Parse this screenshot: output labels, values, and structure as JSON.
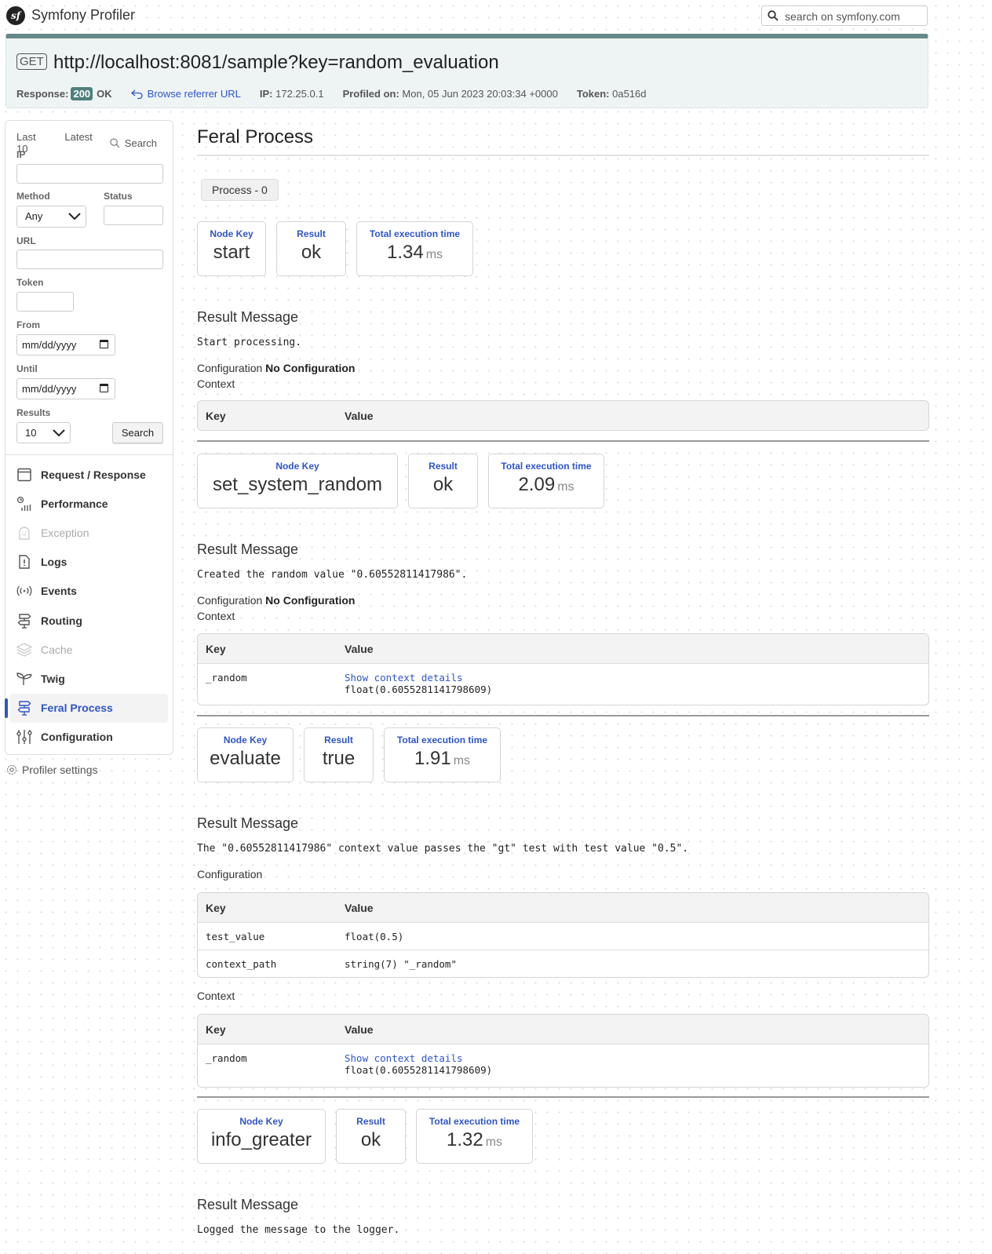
{
  "header": {
    "app_title": "Symfony Profiler",
    "logo_text": "sf",
    "search_placeholder": "search on symfony.com"
  },
  "summary": {
    "method": "GET",
    "url": "http://localhost:8081/sample?key=random_evaluation",
    "response_label": "Response:",
    "status_code": "200",
    "status_text": "OK",
    "referrer_link": "Browse referrer URL",
    "ip_label": "IP:",
    "ip": "172.25.0.1",
    "profiled_label": "Profiled on:",
    "profiled_on": "Mon, 05 Jun 2023 20:03:34 +0000",
    "token_label": "Token:",
    "token": "0a516d",
    "accent_color": "#638a88"
  },
  "sidebar": {
    "tabs": [
      "Last 10",
      "Latest",
      "Search"
    ],
    "form": {
      "ip_label": "IP",
      "ip_value": "",
      "method_label": "Method",
      "method_value": "Any",
      "status_label": "Status",
      "status_value": "",
      "url_label": "URL",
      "url_value": "",
      "token_label": "Token",
      "token_value": "",
      "from_label": "From",
      "from_placeholder": "mm/dd/yyyy",
      "until_label": "Until",
      "until_placeholder": "mm/dd/yyyy",
      "results_label": "Results",
      "results_value": "10",
      "search_button": "Search"
    },
    "menu": [
      {
        "label": "Request / Response",
        "icon": "request-response-icon",
        "state": "normal"
      },
      {
        "label": "Performance",
        "icon": "performance-icon",
        "state": "normal"
      },
      {
        "label": "Exception",
        "icon": "exception-icon",
        "state": "disabled"
      },
      {
        "label": "Logs",
        "icon": "logs-icon",
        "state": "normal"
      },
      {
        "label": "Events",
        "icon": "events-icon",
        "state": "normal"
      },
      {
        "label": "Routing",
        "icon": "routing-icon",
        "state": "normal"
      },
      {
        "label": "Cache",
        "icon": "cache-icon",
        "state": "disabled"
      },
      {
        "label": "Twig",
        "icon": "twig-icon",
        "state": "normal"
      },
      {
        "label": "Feral Process",
        "icon": "feral-process-icon",
        "state": "active"
      },
      {
        "label": "Configuration",
        "icon": "configuration-icon",
        "state": "normal"
      }
    ],
    "profiler_settings": "Profiler settings",
    "active_color": "#2f55c6"
  },
  "main": {
    "title": "Feral Process",
    "tab": "Process - 0",
    "labels": {
      "node_key": "Node Key",
      "result": "Result",
      "exec_time": "Total execution time",
      "unit": "ms",
      "result_message": "Result Message",
      "configuration": "Configuration",
      "no_configuration": "No Configuration",
      "context": "Context",
      "key_col": "Key",
      "value_col": "Value",
      "show_details": "Show context details"
    },
    "nodes": [
      {
        "node_key": "start",
        "result": "ok",
        "time": "1.34",
        "message": "Start processing.",
        "configuration": [],
        "context": []
      },
      {
        "node_key": "set_system_random",
        "result": "ok",
        "time": "2.09",
        "message": "Created the random value \"0.60552811417986\".",
        "configuration": [],
        "context": [
          {
            "key": "_random",
            "link": "Show context details",
            "value": "float(0.6055281141798609)"
          }
        ]
      },
      {
        "node_key": "evaluate",
        "result": "true",
        "time": "1.91",
        "message": "The \"0.60552811417986\" context value passes the \"gt\" test with test value \"0.5\".",
        "configuration": [
          {
            "key": "test_value",
            "value": "float(0.5)"
          },
          {
            "key": "context_path",
            "value": "string(7) \"_random\""
          }
        ],
        "context": [
          {
            "key": "_random",
            "link": "Show context details",
            "value": "float(0.6055281141798609)"
          }
        ]
      },
      {
        "node_key": "info_greater",
        "result": "ok",
        "time": "1.32",
        "message": "Logged the message to the logger."
      }
    ]
  }
}
